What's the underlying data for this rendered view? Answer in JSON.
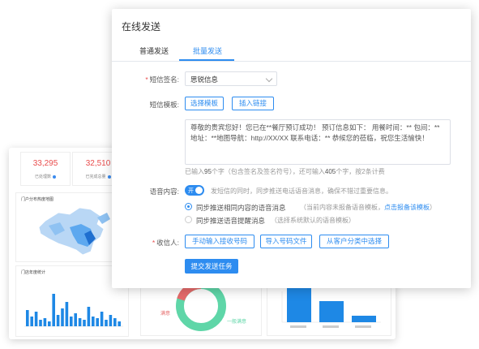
{
  "background": {
    "stats": [
      {
        "value": "33,295",
        "label": "已处理数"
      },
      {
        "value": "32,510",
        "label": "已完成总量"
      }
    ],
    "map_title": "门户分布热度地图",
    "bar_title": "门店年度统计",
    "pie_left_label": "满意",
    "pie_right_label": "一般满意",
    "colors": {
      "red_stat": "#e94d4d",
      "map_blue": "#5da8ef",
      "bar_blue": "#1e88e5",
      "pie_red": "#e66b6b",
      "pie_green": "#5fd6a8"
    }
  },
  "dialog": {
    "title": "在线发送",
    "tabs": [
      {
        "label": "普通发送",
        "active": false
      },
      {
        "label": "批量发送",
        "active": true
      }
    ],
    "signature": {
      "label": "短信签名:",
      "value": "思锐信息"
    },
    "template": {
      "label": "短信模板:",
      "select_button": "选择模板",
      "insert_link_button": "插入链接"
    },
    "message": "尊敬的贵宾您好！您已在**餐厅预订成功！ 预订信息如下： 用餐时间：** 包间：** 地址：**地图导航：http://XX/XX 联系电话：** 恭候您的莅临，祝您生活愉快！",
    "count": {
      "prefix": "已输入",
      "typed": "95",
      "middle": "个字（包含签名及签名符号），还可输入",
      "remaining": "405",
      "suffix": "个字，按2条计费"
    },
    "voice": {
      "label": "语音内容:",
      "toggle_text": "开",
      "toggle_hint": "发短信的同时，同步推送电话语音消息，确保不错过重要信息。",
      "options": [
        {
          "label": "同步推送相同内容的语音消息",
          "hint": "（当前内容未报备语音模板，",
          "link": "点击报备该模板",
          "tail": "）",
          "checked": true
        },
        {
          "label": "同步推送语音提醒消息",
          "hint": "（选择系统默认的语音模板）",
          "link": "",
          "tail": "",
          "checked": false
        }
      ]
    },
    "recipients": {
      "label": "收信人:",
      "buttons": [
        "手动输入接收号码",
        "导入号码文件",
        "从客户分类中选择"
      ]
    },
    "submit_label": "提交发送任务",
    "accent_color": "#2d8cf0"
  }
}
